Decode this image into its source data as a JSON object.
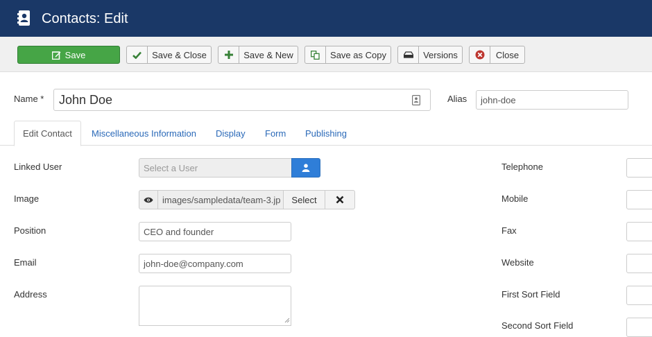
{
  "header": {
    "title": "Contacts: Edit",
    "icon": "address-book-icon",
    "background": "#1a3867"
  },
  "toolbar": {
    "save": "Save",
    "save_close": "Save & Close",
    "save_new": "Save & New",
    "save_copy": "Save as Copy",
    "versions": "Versions",
    "close": "Close"
  },
  "form": {
    "name_label": "Name *",
    "name_value": "John Doe",
    "alias_label": "Alias",
    "alias_value": "john-doe"
  },
  "tabs": [
    {
      "label": "Edit Contact",
      "active": true
    },
    {
      "label": "Miscellaneous Information",
      "active": false
    },
    {
      "label": "Display",
      "active": false
    },
    {
      "label": "Form",
      "active": false
    },
    {
      "label": "Publishing",
      "active": false
    }
  ],
  "left_fields": {
    "linked_user_label": "Linked User",
    "linked_user_placeholder": "Select a User",
    "image_label": "Image",
    "image_value": "images/sampledata/team-3.jp",
    "image_select": "Select",
    "position_label": "Position",
    "position_value": "CEO and founder",
    "email_label": "Email",
    "email_value": "john-doe@company.com",
    "address_label": "Address"
  },
  "right_fields": {
    "telephone_label": "Telephone",
    "mobile_label": "Mobile",
    "fax_label": "Fax",
    "website_label": "Website",
    "first_sort_label": "First Sort Field",
    "second_sort_label": "Second Sort Field"
  },
  "colors": {
    "save_green": "#46a546",
    "link_blue": "#2a69b8",
    "user_button_blue": "#2f7ed8"
  }
}
